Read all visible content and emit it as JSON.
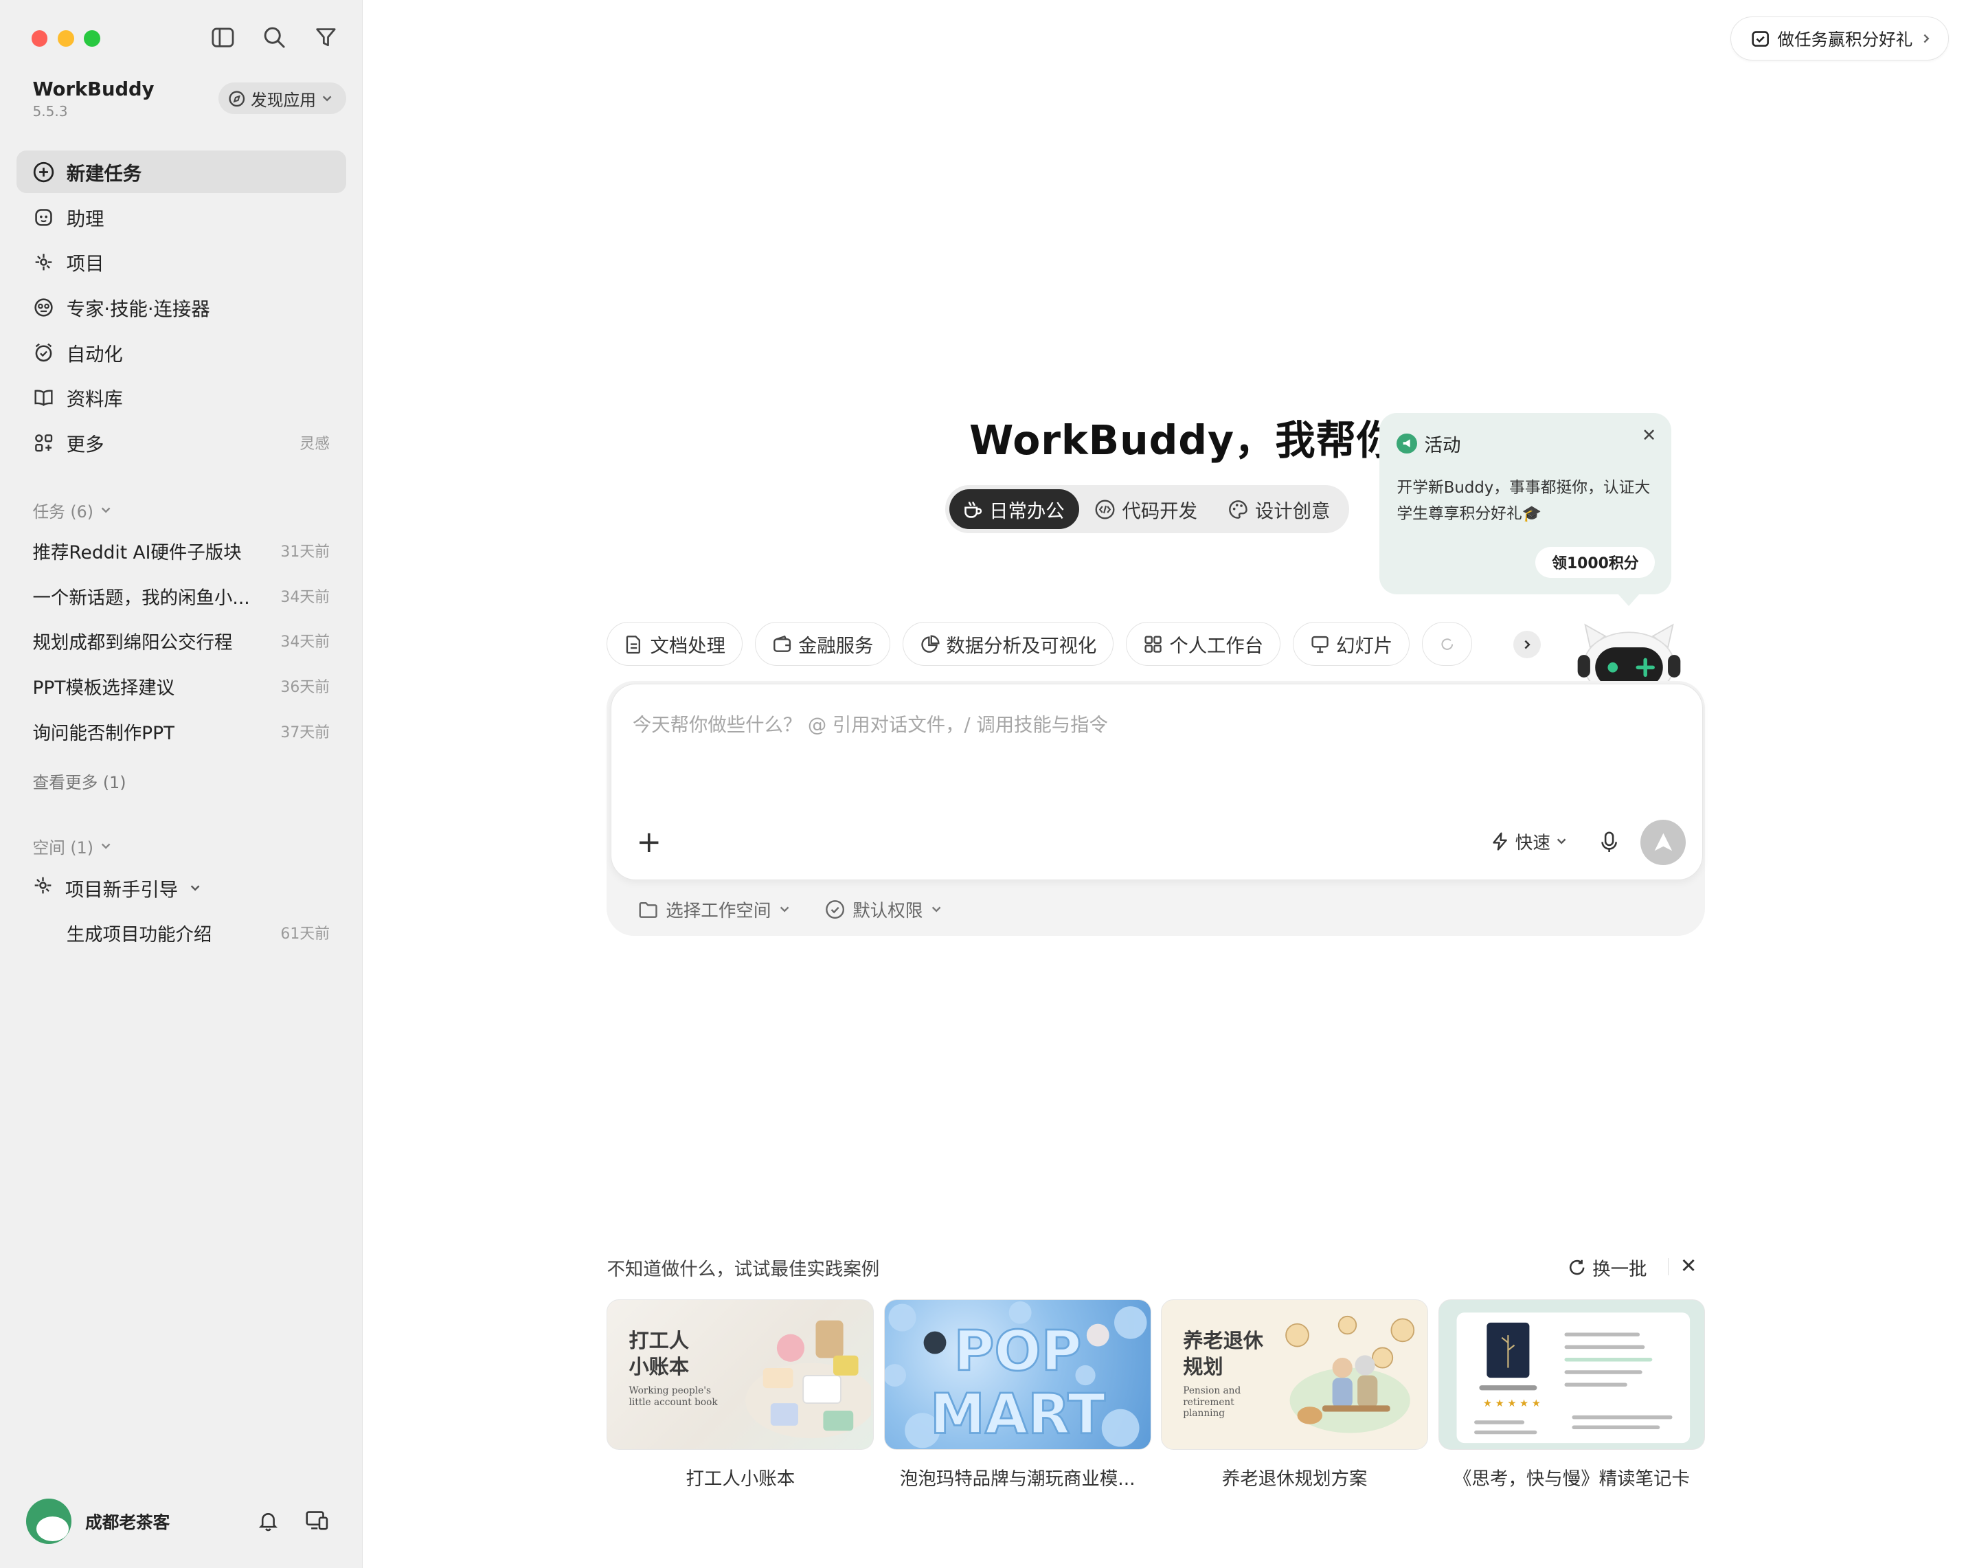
{
  "app": {
    "name": "WorkBuddy",
    "version": "5.5.3",
    "discover_label": "发现应用"
  },
  "nav": [
    {
      "label": "新建任务",
      "icon": "plus-circle-icon",
      "extra": ""
    },
    {
      "label": "助理",
      "icon": "assistant-icon",
      "extra": ""
    },
    {
      "label": "项目",
      "icon": "project-icon",
      "extra": ""
    },
    {
      "label": "专家·技能·连接器",
      "icon": "expert-icon",
      "extra": ""
    },
    {
      "label": "自动化",
      "icon": "alarm-clock-icon",
      "extra": ""
    },
    {
      "label": "资料库",
      "icon": "book-icon",
      "extra": ""
    },
    {
      "label": "更多",
      "icon": "grid-icon",
      "extra": "灵感"
    }
  ],
  "tasks": {
    "title": "任务 (6)",
    "items": [
      {
        "title": "推荐Reddit AI硬件子版块",
        "date": "31天前"
      },
      {
        "title": "一个新话题，我的闲鱼小...",
        "date": "34天前"
      },
      {
        "title": "规划成都到绵阳公交行程",
        "date": "34天前"
      },
      {
        "title": "PPT模板选择建议",
        "date": "36天前"
      },
      {
        "title": "询问能否制作PPT",
        "date": "37天前"
      }
    ],
    "more": "查看更多 (1)"
  },
  "spaces": {
    "title": "空间 (1)",
    "project": "项目新手引导",
    "sub_task": {
      "title": "生成项目功能介绍",
      "date": "61天前"
    }
  },
  "user": {
    "name": "成都老茶客"
  },
  "promo": {
    "label": "做任务赢积分好礼"
  },
  "hero": {
    "title": "WorkBuddy，我帮你"
  },
  "modes": [
    {
      "label": "日常办公",
      "icon": "coffee-cup-icon"
    },
    {
      "label": "代码开发",
      "icon": "code-icon"
    },
    {
      "label": "设计创意",
      "icon": "palette-icon"
    }
  ],
  "activity": {
    "title": "活动",
    "body": "开学新Buddy，事事都挺你，认证大学生尊享积分好礼🎓",
    "cta": "领1000积分"
  },
  "chips": [
    {
      "label": "文档处理",
      "icon": "document-icon"
    },
    {
      "label": "金融服务",
      "icon": "wallet-icon"
    },
    {
      "label": "数据分析及可视化",
      "icon": "pie-chart-icon"
    },
    {
      "label": "个人工作台",
      "icon": "grid-icon"
    },
    {
      "label": "幻灯片",
      "icon": "presentation-icon"
    }
  ],
  "composer": {
    "placeholder": "今天帮你做些什么？ @ 引用对话文件，/ 调用技能与指令",
    "speed_label": "快速",
    "workspace_label": "选择工作空间",
    "permission_label": "默认权限"
  },
  "cases": {
    "title": "不知道做什么，试试最佳实践案例",
    "refresh_label": "换一批",
    "items": [
      {
        "caption": "打工人小账本",
        "art_title_1": "打工人",
        "art_title_2": "小账本",
        "art_sub_1": "Working people's",
        "art_sub_2": "little account book"
      },
      {
        "caption": "泡泡玛特品牌与潮玩商业模...",
        "art_text_1": "POP",
        "art_text_2": "MART"
      },
      {
        "caption": "养老退休规划方案",
        "art_title_1": "养老退休",
        "art_title_2": "规划",
        "art_sub_1": "Pension and",
        "art_sub_2": "retirement",
        "art_sub_3": "planning"
      },
      {
        "caption": "《思考，快与慢》精读笔记卡"
      }
    ]
  },
  "colors": {
    "accent_green": "#3aa776",
    "dark_pill": "#2b2b2b",
    "sidebar_bg": "#f0f0f0"
  }
}
